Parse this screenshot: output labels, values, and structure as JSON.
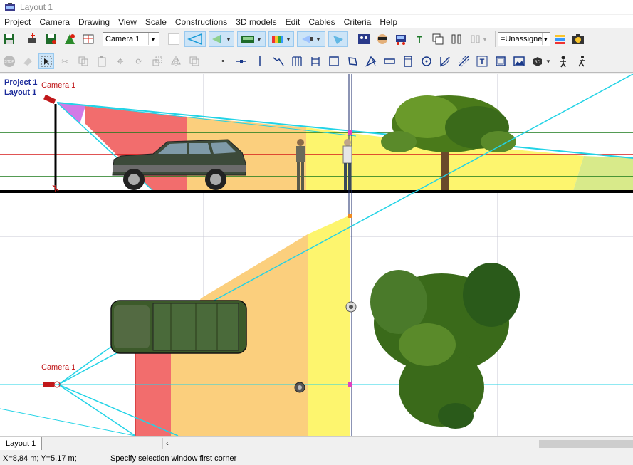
{
  "window": {
    "title": "Layout 1"
  },
  "menu": [
    "Project",
    "Camera",
    "Drawing",
    "View",
    "Scale",
    "Constructions",
    "3D models",
    "Edit",
    "Cables",
    "Criteria",
    "Help"
  ],
  "toolbar": {
    "camera_select": "Camera 1",
    "unassigned_select": "=Unassigne",
    "text_tool_label": "T",
    "text_tool2_label": "T",
    "stop_label": "STOP",
    "threed_label": "3D"
  },
  "canvas": {
    "project_label": "Project 1",
    "layout_label": "Layout 1",
    "camera_side_label": "Camera 1",
    "camera_top_label": "Camera 1"
  },
  "tabs": [
    "Layout 1"
  ],
  "status": {
    "coords": "X=8,84 m; Y=5,17 m;",
    "message": "Specify selection window first corner"
  },
  "colors": {
    "accent": "#cce4f7",
    "fov_red": "#f26d6d",
    "fov_orange": "#fbcf7d",
    "fov_yellow": "#fdf56e",
    "fov_violet": "#d27ae6",
    "cyan_line": "#22d3e6",
    "green_line": "#1b7a1b",
    "red_line": "#d51a1a",
    "label_blue": "#1a2a9a",
    "camera_red": "#c0181a"
  }
}
